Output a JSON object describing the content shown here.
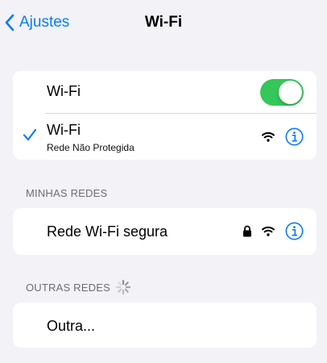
{
  "navbar": {
    "back_label": "Ajustes",
    "title": "Wi-Fi"
  },
  "wifi_toggle": {
    "label": "Wi-Fi",
    "enabled": true
  },
  "current_network": {
    "name": "Wi-Fi",
    "subtitle": "Rede Não Protegida"
  },
  "my_networks": {
    "header": "MINHAS REDES",
    "items": [
      {
        "name": "Rede Wi-Fi segura",
        "locked": true
      }
    ]
  },
  "other_networks": {
    "header": "OUTRAS REDES",
    "other_label": "Outra..."
  },
  "colors": {
    "accent": "#0a7aff",
    "toggle_on": "#34c759",
    "background": "#f2f2f7",
    "section_header": "#6d6d72"
  }
}
